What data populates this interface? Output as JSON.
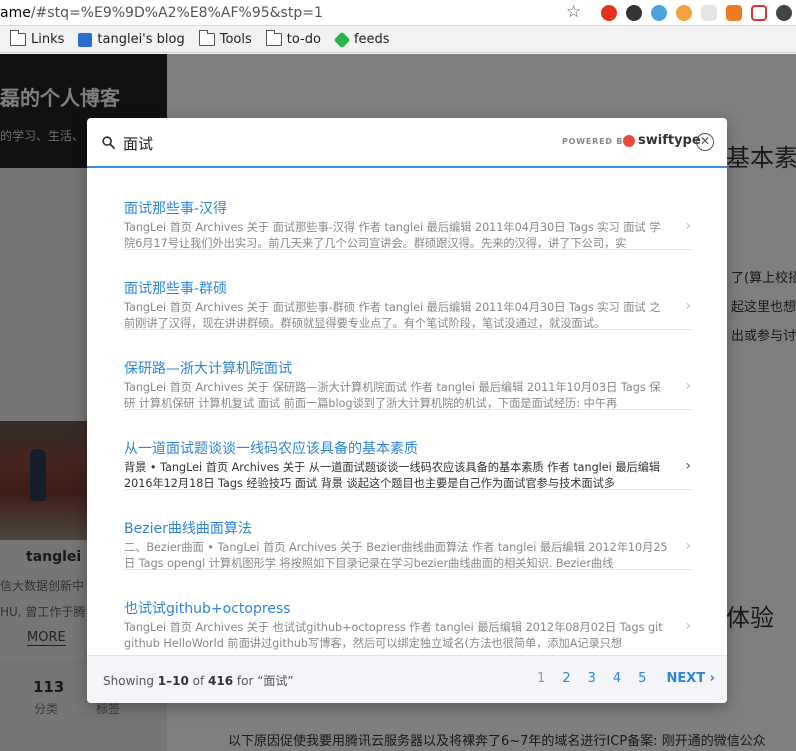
{
  "browser": {
    "url_host": "ame",
    "url_rest": "/#stq=%E9%9D%A2%E8%AF%95&stp=1",
    "bookmarks": [
      {
        "label": "Links",
        "icon": "folder-icon"
      },
      {
        "label": "tanglei's blog",
        "icon": "blog-favicon"
      },
      {
        "label": "Tools",
        "icon": "folder-icon"
      },
      {
        "label": "to-do",
        "icon": "folder-icon"
      },
      {
        "label": "feeds",
        "icon": "feedly-icon"
      }
    ]
  },
  "blog": {
    "title": "磊的个人博客",
    "subtitle": "的学习、生活、",
    "author": "tanglei",
    "bio1": "信大数据创新中",
    "bio2": "HU, 曾工作于腾",
    "more": "MORE",
    "stat_count": "113",
    "stat_label1": "分类",
    "stat_label2": "标签",
    "bg_heading1": "基本素质",
    "bg_text1": "了(算上校招",
    "bg_text2": "起这里也想说",
    "bg_text3": "出或参与讨",
    "bg_heading2": "体验",
    "bg_bottom": "以下原因促使我要用腾讯云服务器以及将裸奔了6~7年的域名进行ICP备案: 刚开通的微信公众"
  },
  "search": {
    "query": "面试",
    "powered_by": "POWERED BY",
    "brand": "swiftype",
    "close": "✕",
    "results": [
      {
        "title": "面试那些事-汉得",
        "snippet": "TangLei 首页 Archives 关于 面试那些事-汉得 作者 tanglei 最后编辑 2011年04月30日 Tags 实习 面试 学院6月17号让我们外出实习。前几天来了几个公司宣讲会。群硕跟汉得。先来的汉得，讲了下公司，实"
      },
      {
        "title": "面试那些事-群硕",
        "snippet": "TangLei 首页 Archives 关于 面试那些事-群硕 作者 tanglei 最后编辑 2011年04月30日 Tags 实习 面试 之前刚讲了汉得，现在讲讲群硕。群硕就显得要专业点了。有个笔试阶段，笔试没通过，就没面试。"
      },
      {
        "title": "保研路—浙大计算机院面试",
        "snippet": "TangLei 首页 Archives 关于 保研路—浙大计算机院面试 作者 tanglei 最后编辑 2011年10月03日 Tags 保研 计算机保研 计算机复试 面试 前面一篇blog谈到了浙大计算机院的机试，下面是面试经历: 中午再"
      },
      {
        "title": "从一道面试题谈谈一线码农应该具备的基本素质",
        "snippet": "背景 • TangLei 首页 Archives 关于 从一道面试题谈谈一线码农应该具备的基本素质 作者 tanglei 最后编辑 2016年12月18日 Tags 经验技巧 面试 背景 谈起这个题目也主要是自己作为面试官参与技术面试多"
      },
      {
        "title": "Bezier曲线曲面算法",
        "snippet": "二、Bezier曲面 • TangLei 首页 Archives 关于 Bezier曲线曲面算法 作者 tanglei 最后编辑 2012年10月25日 Tags opengl 计算机图形学 将按照如下目录记录在学习bezier曲线曲面的相关知识. Bezier曲线"
      },
      {
        "title": "也试试github+octopress",
        "snippet": "TangLei 首页 Archives 关于 也试试github+octopress 作者 tanglei 最后编辑 2012年08月02日 Tags git github HelloWorld 前面讲过github写博客，然后可以绑定独立域名(方法也很简单，添加A记录只想"
      }
    ],
    "footer": {
      "showing_prefix": "Showing ",
      "range": "1–10",
      "of": " of ",
      "total": "416",
      "for": " for “面试”",
      "pages": [
        "1",
        "2",
        "3",
        "4",
        "5"
      ],
      "next": "NEXT"
    }
  }
}
